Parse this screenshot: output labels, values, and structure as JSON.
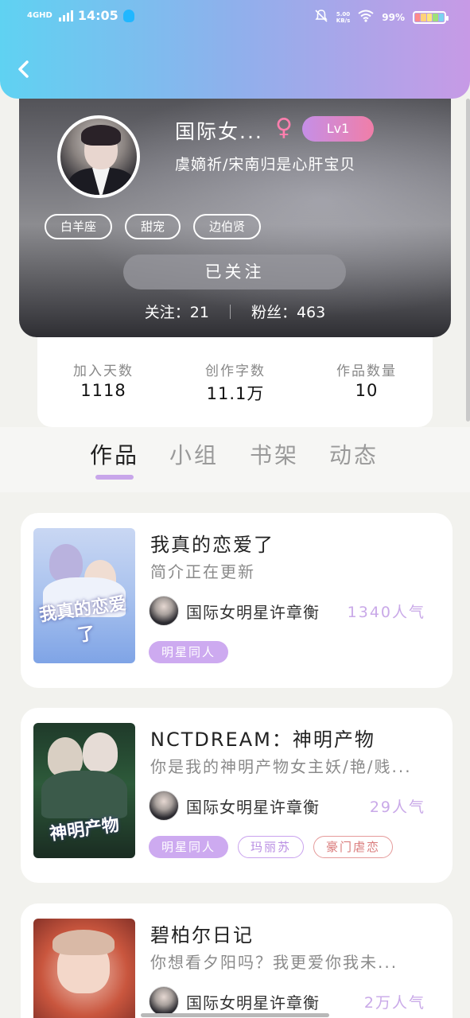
{
  "status_bar": {
    "network": "4GHD",
    "time": "14:05",
    "speed_value": "5.00",
    "speed_unit": "KB/s",
    "battery_pct": "99%"
  },
  "header": {
    "back_icon": "chevron-left-icon"
  },
  "profile": {
    "nickname": "国际女...",
    "gender_symbol": "♀",
    "level": "Lv1",
    "signature": "虞嫡祈/宋南归是心肝宝贝",
    "tags": [
      "白羊座",
      "甜宠",
      "边伯贤"
    ],
    "follow_button": "已关注",
    "following_label": "关注：21",
    "fans_label": "粉丝：463"
  },
  "stats": [
    {
      "label": "加入天数",
      "value": "1118"
    },
    {
      "label": "创作字数",
      "value": "11.1万"
    },
    {
      "label": "作品数量",
      "value": "10"
    }
  ],
  "tabs": [
    {
      "label": "作品",
      "active": true
    },
    {
      "label": "小组",
      "active": false
    },
    {
      "label": "书架",
      "active": false
    },
    {
      "label": "动态",
      "active": false
    }
  ],
  "books": [
    {
      "title": "我真的恋爱了",
      "intro": "简介正在更新",
      "cover_text": "我真的恋爱了",
      "author": "国际女明星许章衡",
      "popularity": "1340人气",
      "tags": [
        {
          "text": "明星同人",
          "style": "fill"
        }
      ]
    },
    {
      "title": "NCTDREAM：神明产物",
      "intro": "你是我的神明产物女主妖/艳/贱...",
      "cover_text": "神明产物",
      "author": "国际女明星许章衡",
      "popularity": "29人气",
      "tags": [
        {
          "text": "明星同人",
          "style": "fill"
        },
        {
          "text": "玛丽苏",
          "style": "outline-purple"
        },
        {
          "text": "豪门虐恋",
          "style": "outline-red"
        }
      ]
    },
    {
      "title": "碧柏尔日记",
      "intro": "你想看夕阳吗？我更爱你我未...",
      "cover_text": "",
      "author": "国际女明星许章衡",
      "popularity": "2万人气",
      "tags": []
    }
  ],
  "colors": {
    "header_gradient_start": "#5fd2f2",
    "header_gradient_end": "#c79ae6",
    "accent_purple": "#c9a9e8",
    "level_badge_end": "#f07ea8"
  }
}
